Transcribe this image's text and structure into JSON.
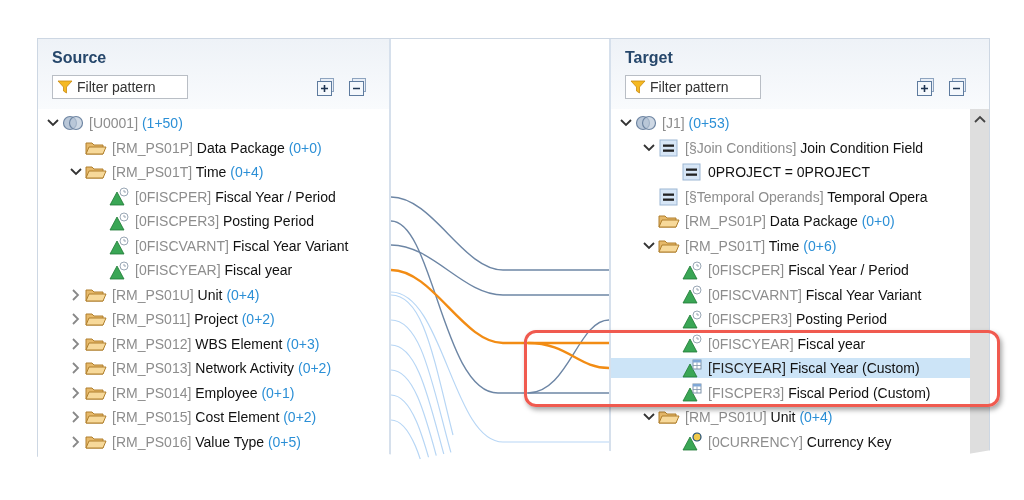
{
  "source": {
    "title": "Source",
    "filter": {
      "placeholder": "Filter pattern"
    },
    "tree": [
      {
        "kind": "union",
        "key": "[U0001]",
        "count": "(1+50)",
        "selected": false,
        "expanded": true,
        "children": [
          {
            "kind": "folder",
            "key": "[RM_PS01P]",
            "label": "Data Package",
            "count": "(0+0)",
            "selected": false
          },
          {
            "kind": "folder",
            "key": "[RM_PS01T]",
            "label": "Time",
            "count": "(0+4)",
            "selected": false,
            "expanded": true,
            "children": [
              {
                "kind": "characteristic",
                "key": "[0FISCPER]",
                "label": "Fiscal Year / Period",
                "selected": false
              },
              {
                "kind": "characteristic",
                "key": "[0FISCPER3]",
                "label": "Posting Period",
                "selected": false
              },
              {
                "kind": "characteristic",
                "key": "[0FISCVARNT]",
                "label": "Fiscal Year Variant",
                "selected": false
              },
              {
                "kind": "characteristic",
                "key": "[0FISCYEAR]",
                "label": "Fiscal year",
                "selected": false
              }
            ]
          },
          {
            "kind": "folder",
            "key": "[RM_PS01U]",
            "label": "Unit",
            "count": "(0+4)",
            "selected": false,
            "expanded": false
          },
          {
            "kind": "folder",
            "key": "[RM_PS011]",
            "label": "Project",
            "count": "(0+2)",
            "selected": false,
            "expanded": false
          },
          {
            "kind": "folder",
            "key": "[RM_PS012]",
            "label": "WBS Element",
            "count": "(0+3)",
            "selected": false,
            "expanded": false
          },
          {
            "kind": "folder",
            "key": "[RM_PS013]",
            "label": "Network Activity",
            "count": "(0+2)",
            "selected": false,
            "expanded": false
          },
          {
            "kind": "folder",
            "key": "[RM_PS014]",
            "label": "Employee",
            "count": "(0+1)",
            "selected": false,
            "expanded": false
          },
          {
            "kind": "folder",
            "key": "[RM_PS015]",
            "label": "Cost Element",
            "count": "(0+2)",
            "selected": false,
            "expanded": false
          },
          {
            "kind": "folder",
            "key": "[RM_PS016]",
            "label": "Value Type",
            "count": "(0+5)",
            "selected": false,
            "expanded": false
          }
        ]
      }
    ]
  },
  "target": {
    "title": "Target",
    "filter": {
      "placeholder": "Filter pattern"
    },
    "tree": [
      {
        "kind": "union",
        "key": "[J1]",
        "count": "(0+53)",
        "selected": false,
        "expanded": true,
        "children": [
          {
            "kind": "condition",
            "key": "[§Join Conditions]",
            "label": "Join Condition Field",
            "selected": false,
            "expanded": true,
            "children": [
              {
                "kind": "condition",
                "label": "0PROJECT = 0PROJECT",
                "selected": false
              }
            ]
          },
          {
            "kind": "condition",
            "key": "[§Temporal Operands]",
            "label": "Temporal Opera",
            "selected": false
          },
          {
            "kind": "folder",
            "key": "[RM_PS01P]",
            "label": "Data Package",
            "count": "(0+0)",
            "selected": false
          },
          {
            "kind": "folder",
            "key": "[RM_PS01T]",
            "label": "Time",
            "count": "(0+6)",
            "selected": false,
            "expanded": true,
            "children": [
              {
                "kind": "characteristic",
                "key": "[0FISCPER]",
                "label": "Fiscal Year / Period",
                "selected": false
              },
              {
                "kind": "characteristic",
                "key": "[0FISCVARNT]",
                "label": "Fiscal Year Variant",
                "selected": false
              },
              {
                "kind": "characteristic",
                "key": "[0FISCPER3]",
                "label": "Posting Period",
                "selected": false
              },
              {
                "kind": "characteristic",
                "key": "[0FISCYEAR]",
                "label": "Fiscal year",
                "selected": false
              },
              {
                "kind": "custom",
                "key": "[FISCYEAR]",
                "label": "Fiscal Year (Custom)",
                "selected": true
              },
              {
                "kind": "custom",
                "key": "[FISCPER3]",
                "label": "Fiscal Period (Custom)",
                "selected": false
              }
            ]
          },
          {
            "kind": "folder",
            "key": "[RM_PS01U]",
            "label": "Unit",
            "count": "(0+4)",
            "selected": false,
            "expanded": true,
            "children": [
              {
                "kind": "key_figure",
                "key": "[0CURRENCY]",
                "label": "Currency Key",
                "selected": false
              }
            ]
          }
        ]
      }
    ]
  }
}
